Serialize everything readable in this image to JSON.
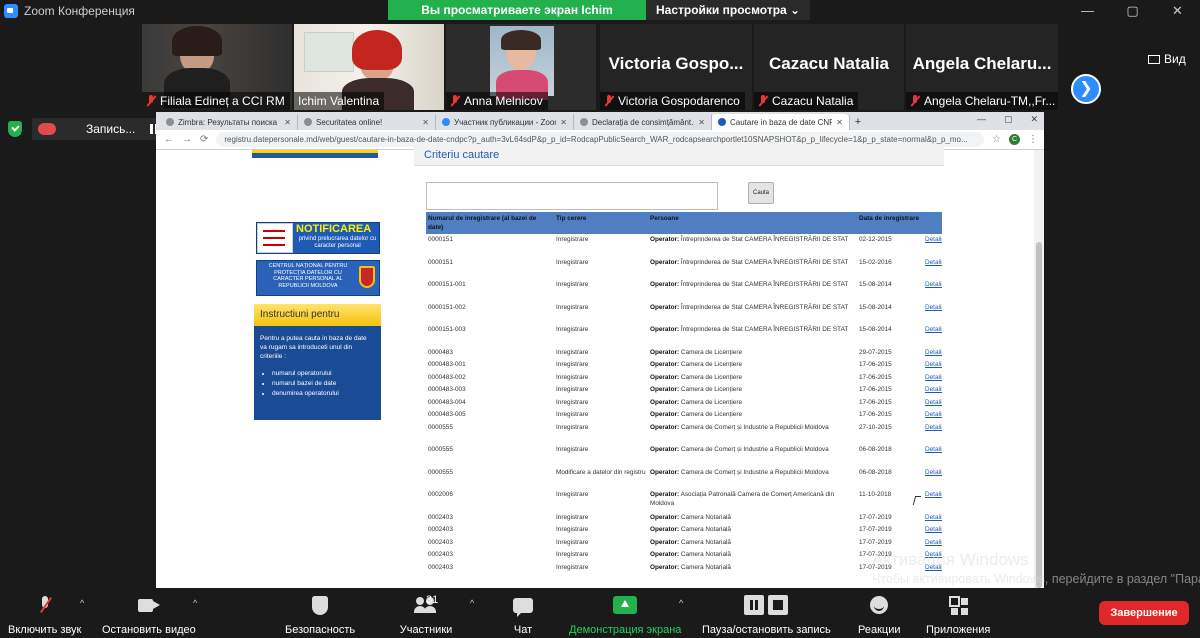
{
  "window": {
    "title": "Zoom Конференция",
    "controls": [
      "—",
      "▢",
      "✕"
    ]
  },
  "share_banner": {
    "message": "Вы просматриваете экран Ichim Valentina",
    "options_label": "Настройки просмотра",
    "options_caret": "⌄"
  },
  "participants": [
    {
      "name": "Filiala Edineț a CCI RM",
      "muted": true,
      "video": true
    },
    {
      "name": "Ichim Valentina",
      "muted": false,
      "video": true,
      "active": true
    },
    {
      "name": "Anna Melnicov",
      "muted": true,
      "video": true
    },
    {
      "display_name": "Victoria  Gospo...",
      "name": "Victoria Gospodarenco",
      "muted": true,
      "video": false
    },
    {
      "display_name": "Cazacu Natalia",
      "name": "Cazacu Natalia",
      "muted": true,
      "video": false
    },
    {
      "display_name": "Angela  Chelaru...",
      "name": "Angela Chelaru-TM,,Fr...",
      "muted": true,
      "video": false
    }
  ],
  "next_page_glyph": "❯",
  "view_label": "Вид",
  "recording": {
    "label": "Запись..."
  },
  "browser": {
    "tabs": [
      {
        "label": "Zimbra: Результаты поиска",
        "close": "✕"
      },
      {
        "label": "Securitatea online!",
        "close": "✕"
      },
      {
        "label": "Участник публикации - Zoom",
        "close": "✕"
      },
      {
        "label": "Declarația de consimțământ.pdf",
        "close": "✕"
      },
      {
        "label": "Cautare in baza de date CNPDCP",
        "close": "✕",
        "active": true
      }
    ],
    "new_tab": "+",
    "controls": [
      "—",
      "▢",
      "✕"
    ],
    "url": "registru.datepersonale.md/web/guest/cautare-in-baza-de-date-cndpc?p_auth=3vL64sdP&p_p_id=RodcapPublicSearch_WAR_rodcapsearchportlet10SNAPSHOT&p_p_lifecycle=1&p_p_state=normal&p_p_mo...",
    "profile_initial": "C"
  },
  "page": {
    "banner_notif": {
      "title": "NOTIFICAREA",
      "subtitle": "privind prelucrarea datelor cu caracter personal"
    },
    "banner_cnpdcp": "CENTRUL NAȚIONAL PENTRU PROTECȚIA DATELOR CU CARACTER PERSONAL al Republicii Moldova",
    "instructions": {
      "title": "Instructiuni pentru",
      "text": "Pentru a putea cauta in baza de date va rugam sa introduceti unul din criteriile :",
      "items": [
        "numarul operatorului",
        "numarul bazei de date",
        "denumirea operatorului"
      ]
    },
    "criteria_title": "Criteriu cautare",
    "search_value": "",
    "search_button": "Cauta",
    "table": {
      "headers": [
        "Numarul de inregistrare (al bazei de date)",
        "Tip cerere",
        "Persoane",
        "Data de inregistrare",
        ""
      ],
      "operator_label": "Operator:",
      "rows": [
        {
          "nr": "0000151",
          "tip": "Inregistrare",
          "op": "Întreprinderea de Stat CAMERA ÎNREGISTRĂRII DE STAT",
          "data": "02-12-2015",
          "link": "Detalii"
        },
        {
          "nr": "0000151",
          "tip": "Inregistrare",
          "op": "Întreprinderea de Stat CAMERA ÎNREGISTRĂRII DE STAT",
          "data": "15-02-2016",
          "link": "Detalii"
        },
        {
          "nr": "0000151-001",
          "tip": "Inregistrare",
          "op": "Întreprinderea de Stat CAMERA ÎNREGISTRĂRII DE STAT",
          "data": "15-08-2014",
          "link": "Detalii"
        },
        {
          "nr": "0000151-002",
          "tip": "Inregistrare",
          "op": "Întreprinderea de Stat CAMERA ÎNREGISTRĂRII DE STAT",
          "data": "15-08-2014",
          "link": "Detalii"
        },
        {
          "nr": "0000151-003",
          "tip": "Inregistrare",
          "op": "Întreprinderea de Stat CAMERA ÎNREGISTRĂRII DE STAT",
          "data": "15-08-2014",
          "link": "Detalii"
        },
        {
          "nr": "0000483",
          "tip": "Inregistrare",
          "op": "Camera de Licențiere",
          "data": "29-07-2015",
          "link": "Detalii"
        },
        {
          "nr": "0000483-001",
          "tip": "Inregistrare",
          "op": "Camera de Licențiere",
          "data": "17-06-2015",
          "link": "Detalii"
        },
        {
          "nr": "0000483-002",
          "tip": "Inregistrare",
          "op": "Camera de Licențiere",
          "data": "17-06-2015",
          "link": "Detalii"
        },
        {
          "nr": "0000483-003",
          "tip": "Inregistrare",
          "op": "Camera de Licențiere",
          "data": "17-06-2015",
          "link": "Detalii"
        },
        {
          "nr": "0000483-004",
          "tip": "Inregistrare",
          "op": "Camera de Licențiere",
          "data": "17-06-2015",
          "link": "Detalii"
        },
        {
          "nr": "0000483-005",
          "tip": "Inregistrare",
          "op": "Camera de Licențiere",
          "data": "17-06-2015",
          "link": "Detalii"
        },
        {
          "nr": "0000555",
          "tip": "Inregistrare",
          "op": "Camera de Comerț și Industrie a Republicii Moldova",
          "data": "27-10-2015",
          "link": "Detalii"
        },
        {
          "nr": "0000555",
          "tip": "Inregistrare",
          "op": "Camera de Comerț și Industrie a Republicii Moldova",
          "data": "06-08-2018",
          "link": "Detalii"
        },
        {
          "nr": "0000555",
          "tip": "Modificare a datelor din registru",
          "op": "Camera de Comerț și Industrie a Republicii Moldova",
          "data": "06-08-2018",
          "link": "Detalii"
        },
        {
          "nr": "0002006",
          "tip": "Inregistrare",
          "op": "Asociația Patronală Camera de Comerț Americană din Moldova",
          "data": "11-10-2018",
          "link": "Detalii"
        },
        {
          "nr": "0002403",
          "tip": "Inregistrare",
          "op": "Camera Notarială",
          "data": "17-07-2019",
          "link": "Detalii"
        },
        {
          "nr": "0002403",
          "tip": "Inregistrare",
          "op": "Camera Notarială",
          "data": "17-07-2019",
          "link": "Detalii"
        },
        {
          "nr": "0002403",
          "tip": "Inregistrare",
          "op": "Camera Notarială",
          "data": "17-07-2019",
          "link": "Detalii"
        },
        {
          "nr": "0002403",
          "tip": "Inregistrare",
          "op": "Camera Notarială",
          "data": "17-07-2019",
          "link": "Detalii"
        },
        {
          "nr": "0002403",
          "tip": "Inregistrare",
          "op": "Camera Notarială",
          "data": "17-07-2019",
          "link": "Detalii"
        }
      ]
    }
  },
  "activation": {
    "title": "Активация Windows",
    "text": "Чтобы активировать Windows, перейдите в раздел \"Параметры\"."
  },
  "toolbar": {
    "unmute": "Включить звук",
    "video": "Остановить видео",
    "security": "Безопасность",
    "participants": "Участники",
    "participants_count": "31",
    "chat": "Чат",
    "share": "Демонстрация экрана",
    "record": "Пауза/остановить запись",
    "reactions": "Реакции",
    "apps": "Приложения",
    "end": "Завершение",
    "caret": "^"
  },
  "colors": {
    "zoom_blue": "#2d8cff",
    "share_green": "#23b14d",
    "end_red": "#e02828",
    "header_blue": "#4f7fc2"
  }
}
